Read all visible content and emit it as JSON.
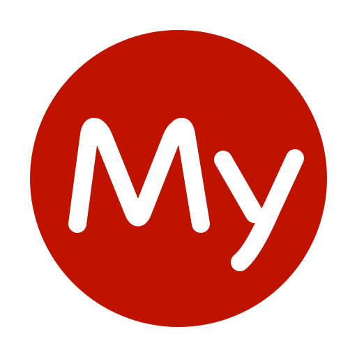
{
  "logo": {
    "text": "My",
    "circle_color": "#BF1300",
    "text_color": "#FFFFFF",
    "background_color": "#FFFFFF"
  }
}
